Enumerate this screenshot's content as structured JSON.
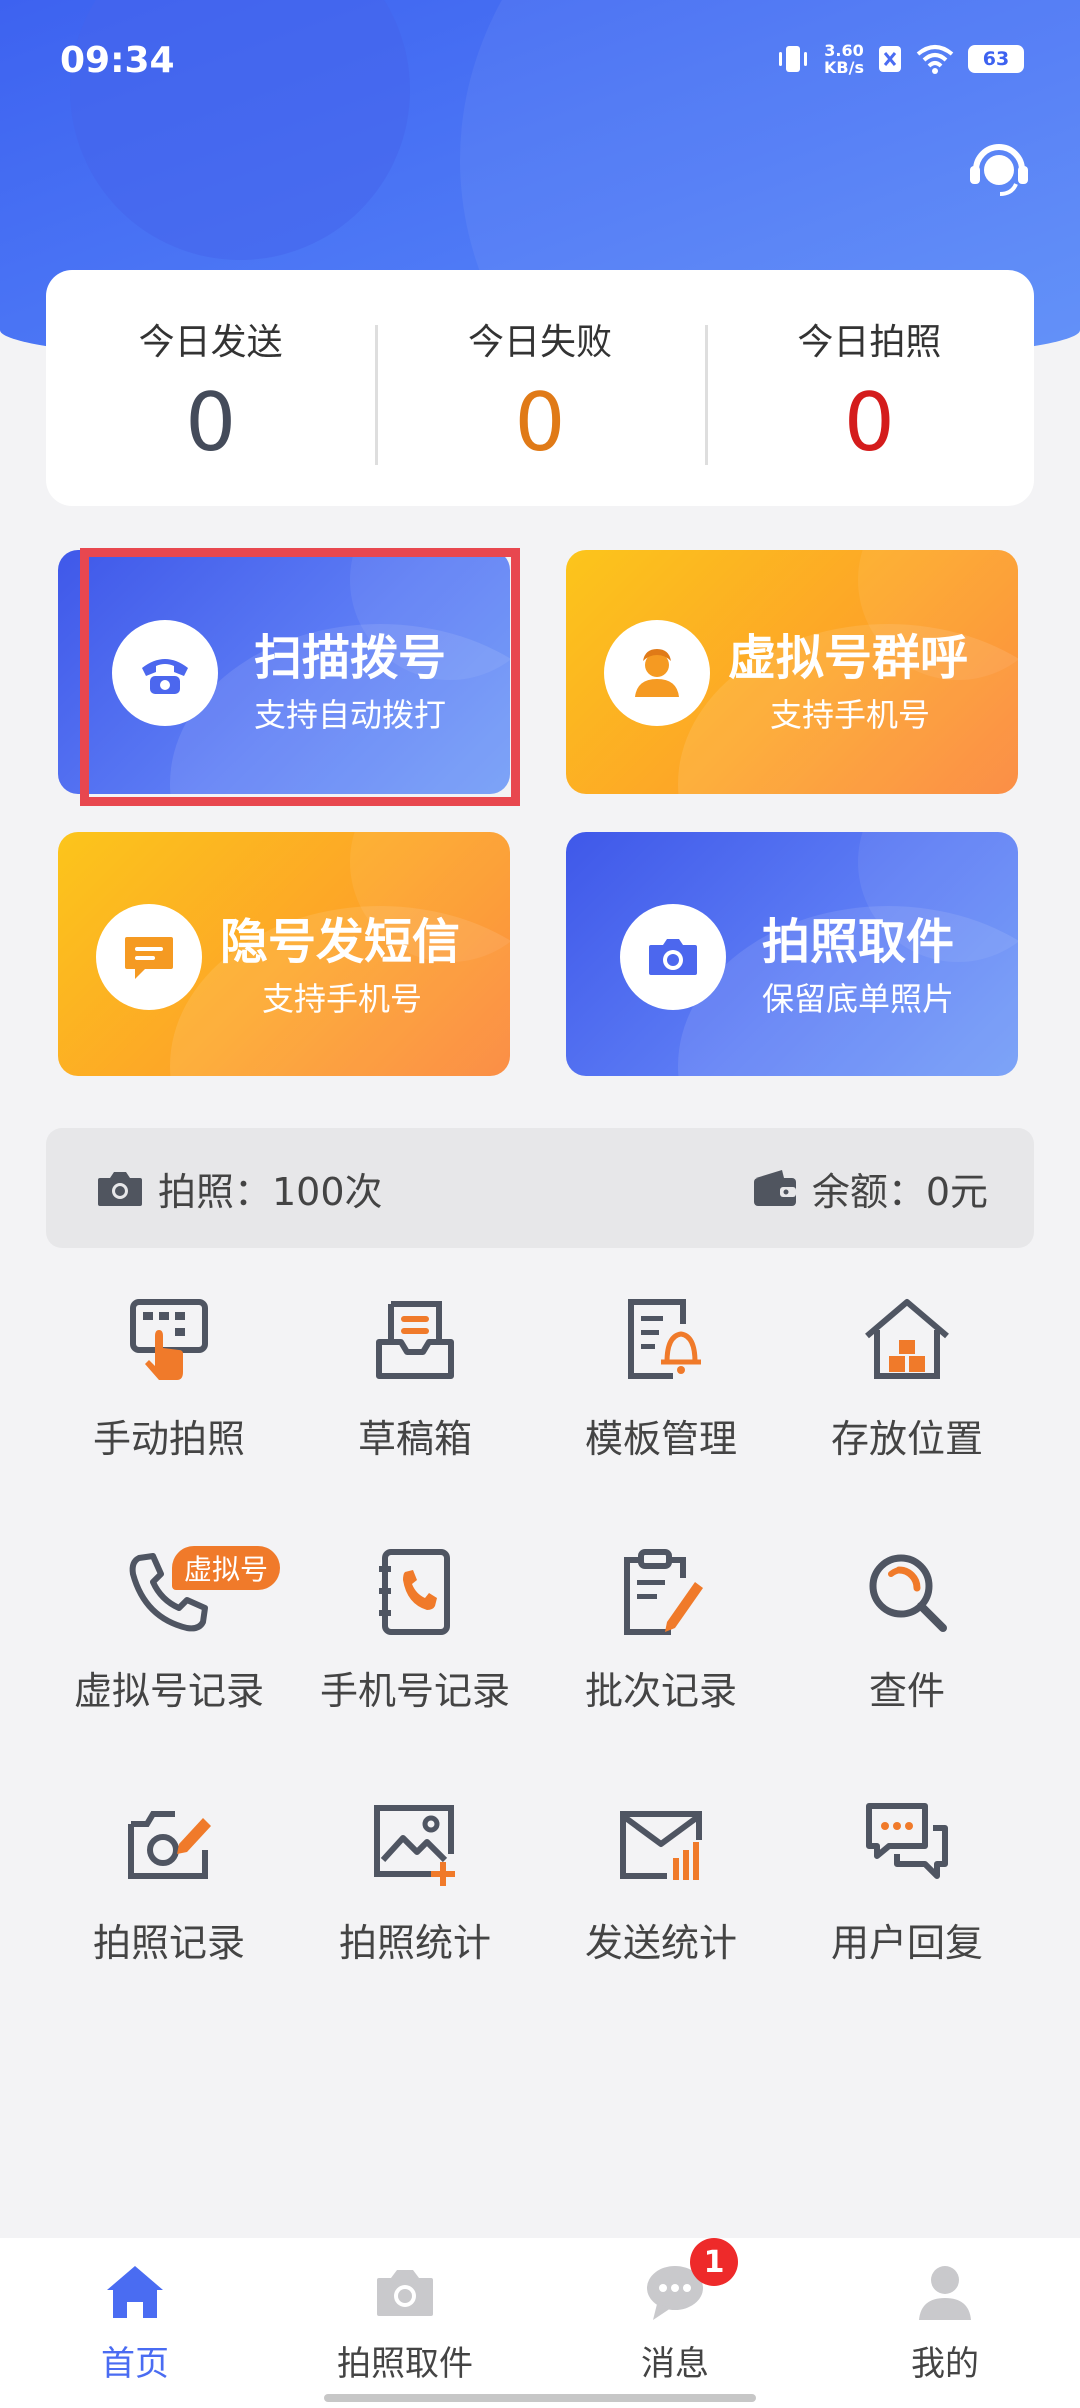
{
  "status_bar": {
    "time": "09:34",
    "net_speed_value": "3.60",
    "net_speed_unit": "KB/s",
    "battery": "63"
  },
  "stats": [
    {
      "label": "今日发送",
      "value": "0",
      "color": "#444b5a"
    },
    {
      "label": "今日失败",
      "value": "0",
      "color": "#e07a17"
    },
    {
      "label": "今日拍照",
      "value": "0",
      "color": "#d41c1c"
    }
  ],
  "cards": [
    {
      "title": "扫描拨号",
      "subtitle": "支持自动拨打",
      "icon": "phone-icon"
    },
    {
      "title": "虚拟号群呼",
      "subtitle": "支持手机号",
      "icon": "person-icon"
    },
    {
      "title": "隐号发短信",
      "subtitle": "支持手机号",
      "icon": "message-icon"
    },
    {
      "title": "拍照取件",
      "subtitle": "保留底单照片",
      "icon": "camera-icon"
    }
  ],
  "info": {
    "photo_text": "拍照：100次",
    "balance_text": "余额：0元"
  },
  "grid": [
    {
      "label": "手动拍照",
      "icon": "manual-photo-icon"
    },
    {
      "label": "草稿箱",
      "icon": "draft-box-icon"
    },
    {
      "label": "模板管理",
      "icon": "template-icon"
    },
    {
      "label": "存放位置",
      "icon": "storage-location-icon"
    },
    {
      "label": "虚拟号记录",
      "icon": "virtual-call-icon"
    },
    {
      "label": "手机号记录",
      "icon": "phonebook-icon"
    },
    {
      "label": "批次记录",
      "icon": "batch-record-icon"
    },
    {
      "label": "查件",
      "icon": "search-icon"
    },
    {
      "label": "拍照记录",
      "icon": "photo-record-icon"
    },
    {
      "label": "拍照统计",
      "icon": "photo-stats-icon"
    },
    {
      "label": "发送统计",
      "icon": "send-stats-icon"
    },
    {
      "label": "用户回复",
      "icon": "user-reply-icon"
    }
  ],
  "virtual_tag": "虚拟号",
  "nav": [
    {
      "label": "首页",
      "icon": "home-icon",
      "active": true
    },
    {
      "label": "拍照取件",
      "icon": "camera-icon",
      "active": false
    },
    {
      "label": "消息",
      "icon": "chat-icon",
      "active": false
    },
    {
      "label": "我的",
      "icon": "profile-icon",
      "active": false
    }
  ],
  "message_badge": "1",
  "colors": {
    "primary": "#4a6cf2",
    "accent_orange": "#f07a2a",
    "icon_dark": "#4f5562"
  }
}
